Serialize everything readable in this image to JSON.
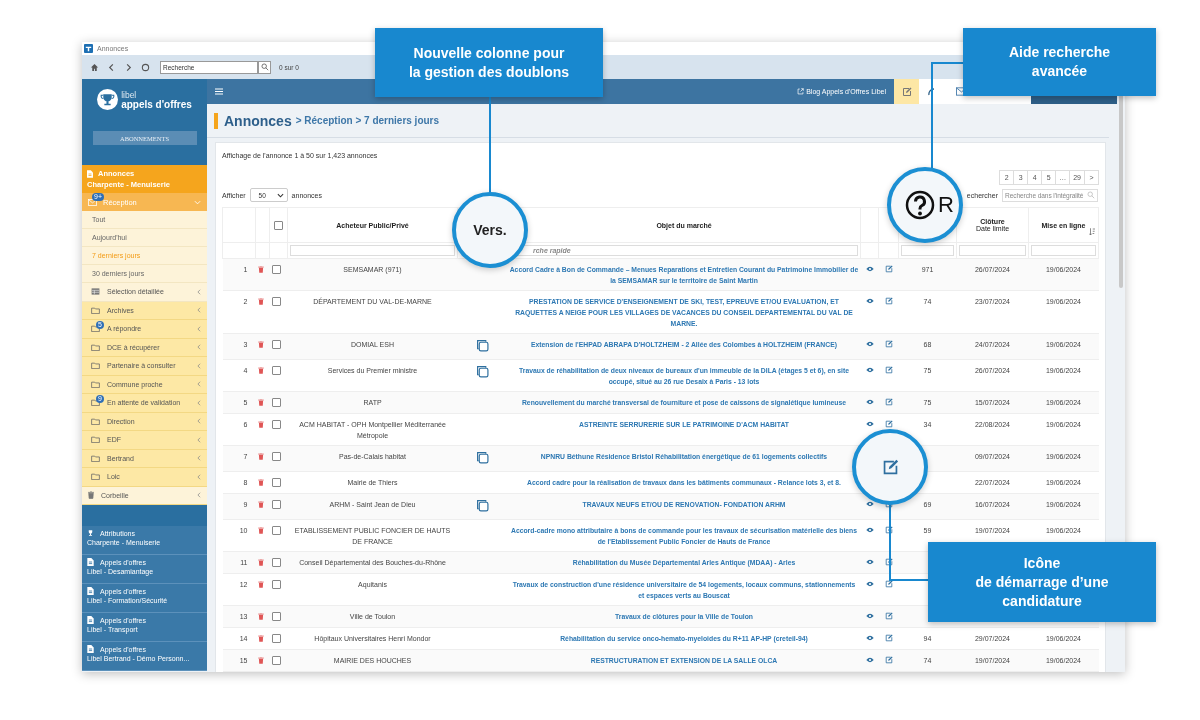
{
  "window": {
    "title": "Annonces"
  },
  "browser": {
    "search_value": "Recherche",
    "results": "0 sur 0"
  },
  "sidebar": {
    "logo": {
      "line1": "libel",
      "line2": "appels d'offres"
    },
    "subscriptions_button": "ABONNEMENTS",
    "current": {
      "title": "Annonces",
      "subtitle": "Charpente - Menuiserie"
    },
    "reception": {
      "label": "Réception",
      "badge": "9+",
      "expanded": true
    },
    "filters": [
      {
        "label": "Tout",
        "selected": false
      },
      {
        "label": "Aujourd'hui",
        "selected": false
      },
      {
        "label": "7 derniers jours",
        "selected": true
      },
      {
        "label": "30 derniers jours",
        "selected": false
      }
    ],
    "folders": [
      {
        "kind": "selection",
        "label": "Sélection détaillée"
      },
      {
        "kind": "folder",
        "label": "Archives"
      },
      {
        "kind": "folder",
        "label": "A répondre",
        "badge": "5"
      },
      {
        "kind": "folder",
        "label": "DCE à récupérer"
      },
      {
        "kind": "folder",
        "label": "Partenaire à consulter"
      },
      {
        "kind": "folder",
        "label": "Commune proche"
      },
      {
        "kind": "folder",
        "label": "En attente de validation",
        "badge": "9"
      },
      {
        "kind": "folder",
        "label": "Direction"
      },
      {
        "kind": "folder",
        "label": "EDF"
      },
      {
        "kind": "folder",
        "label": "Bertrand"
      },
      {
        "kind": "folder",
        "label": "Loic"
      },
      {
        "kind": "trash",
        "label": "Corbeille"
      }
    ],
    "subscriptions": [
      {
        "kind": "trophy",
        "title": "Attributions",
        "subtitle": "Charpente - Menuiserie"
      },
      {
        "kind": "document",
        "title": "Appels d'offres",
        "subtitle": "Libel - Desamiantage"
      },
      {
        "kind": "document",
        "title": "Appels d'offres",
        "subtitle": "Libel - Formation/Sécurité"
      },
      {
        "kind": "document",
        "title": "Appels d'offres",
        "subtitle": "Libel - Transport"
      },
      {
        "kind": "document",
        "title": "Appels d'offres",
        "subtitle": "Libel Bertrand - Démo Personn..."
      }
    ]
  },
  "topbar": {
    "blog_link": "Blog Appels d'Offres Libel"
  },
  "page": {
    "title": "Annonces",
    "breadcrumb": "> Réception > 7 derniers jours"
  },
  "listing": {
    "summary": "Affichage de l'annonce 1 à 50 sur 1,423 annonces",
    "show_label": "Afficher",
    "page_size": "50",
    "show_suffix": "annonces",
    "pagination": [
      {
        "label": "2",
        "selected": false
      },
      {
        "label": "3",
        "selected": false
      },
      {
        "label": "4",
        "selected": false
      },
      {
        "label": "5",
        "selected": false
      },
      {
        "label": "…",
        "selected": false
      },
      {
        "label": "29",
        "selected": false
      },
      {
        "label": ">",
        "selected": false
      }
    ],
    "search_label": "echercher",
    "search_placeholder": "Recherche dans l'intégralité"
  },
  "table": {
    "select_all_checked": false,
    "buyer_header": "Acheteur Public/Privé",
    "object_header": "Objet du marché",
    "closing_header": "Clôture",
    "closing_subheader": "Date limite",
    "online_header": "Mise en ligne",
    "filter_placeholder": "rche rapide",
    "rows": [
      {
        "number": "1",
        "checked": false,
        "buyer": "SEMSAMAR (971)",
        "duplicate": false,
        "object": "Accord Cadre à Bon de Commande – Menues Reparations et Entretien Courant du Patrimoine Immobilier de la SEMSAMAR sur le territoire de Saint Martin",
        "count": "971",
        "closing": "26/07/2024",
        "online": "19/06/2024"
      },
      {
        "number": "2",
        "checked": false,
        "buyer": "DÉPARTEMENT DU VAL-DE-MARNE",
        "duplicate": false,
        "object": "PRESTATION DE SERVICE D'ENSEIGNEMENT DE SKI, TEST, EPREUVE ET/OU EVALUATION, ET RAQUETTES A NEIGE POUR LES VILLAGES DE VACANCES DU CONSEIL DEPARTEMENTAL DU VAL DE MARNE.",
        "count": "74",
        "closing": "23/07/2024",
        "online": "19/06/2024"
      },
      {
        "number": "3",
        "checked": false,
        "buyer": "DOMIAL ESH",
        "duplicate": true,
        "object": "Extension de l'EHPAD ABRAPA D'HOLTZHEIM - 2 Allée des Colombes à HOLTZHEIM (FRANCE)",
        "count": "68",
        "closing": "24/07/2024",
        "online": "19/06/2024"
      },
      {
        "number": "4",
        "checked": false,
        "buyer": "Services du Premier ministre",
        "duplicate": true,
        "object": "Travaux de réhabilitation de deux niveaux de bureaux d'un immeuble de la DILA (étages 5 et 6), en site occupé, situé au 26 rue Desaix à Paris - 13 lots",
        "count": "75",
        "closing": "26/07/2024",
        "online": "19/06/2024"
      },
      {
        "number": "5",
        "checked": false,
        "buyer": "RATP",
        "duplicate": false,
        "object": "Renouvellement du marché transversal de fourniture et pose de caissons de signalétique lumineuse",
        "count": "75",
        "closing": "15/07/2024",
        "online": "19/06/2024"
      },
      {
        "number": "6",
        "checked": false,
        "buyer": "ACM HABITAT - OPH Montpellier Méditerranée Métropole",
        "duplicate": false,
        "object": "ASTREINTE SERRURERIE SUR LE PATRIMOINE D'ACM HABITAT",
        "count": "34",
        "closing": "22/08/2024",
        "online": "19/06/2024"
      },
      {
        "number": "7",
        "checked": false,
        "buyer": "Pas-de-Calais habitat",
        "duplicate": true,
        "object": "NPNRU Béthune Résidence Bristol Réhabilitation énergétique de 61 logements collectifs",
        "show_actions": false,
        "closing": "09/07/2024",
        "online": "19/06/2024"
      },
      {
        "number": "8",
        "checked": false,
        "buyer": "Mairie de Thiers",
        "duplicate": false,
        "object": "Accord cadre pour la réalisation de travaux dans les bâtiments communaux - Relance lots 3, et 8.",
        "show_actions": false,
        "closing": "22/07/2024",
        "online": "19/06/2024"
      },
      {
        "number": "9",
        "checked": false,
        "buyer": "ARHM - Saint Jean de Dieu",
        "duplicate": true,
        "object": "TRAVAUX NEUFS ET/OU DE RENOVATION- FONDATION ARHM",
        "count": "69",
        "closing": "16/07/2024",
        "online": "19/06/2024"
      },
      {
        "number": "10",
        "checked": false,
        "buyer": "ETABLISSEMENT PUBLIC FONCIER DE HAUTS DE FRANCE",
        "duplicate": false,
        "object": "Accord-cadre mono attributaire à bons de commande pour les travaux de sécurisation matérielle des biens de l'Etablissement Public Foncier de Hauts de France",
        "count": "59",
        "closing": "19/07/2024",
        "online": "19/06/2024"
      },
      {
        "number": "11",
        "checked": false,
        "buyer": "Conseil Départemental des Bouches-du-Rhône",
        "duplicate": false,
        "object": "Réhabilitation du Musée Départemental Arles Antique (MDAA) - Arles"
      },
      {
        "number": "12",
        "checked": false,
        "buyer": "Aquitanis",
        "duplicate": false,
        "object": "Travaux de construction d'une résidence universitaire de 54 logements, locaux communs, stationnements et espaces verts au Bouscat"
      },
      {
        "number": "13",
        "checked": false,
        "buyer": "Ville de Toulon",
        "duplicate": false,
        "object": "Travaux de clôtures pour la Ville de Toulon"
      },
      {
        "number": "14",
        "checked": false,
        "buyer": "Hôpitaux Universitaires Henri Mondor",
        "duplicate": false,
        "object": "Réhabilitation du service onco-hemato-myeloides du R+11 AP-HP (creteil-94)",
        "count": "94",
        "closing": "29/07/2024",
        "online": "19/06/2024"
      },
      {
        "number": "15",
        "checked": false,
        "buyer": "MAIRIE DES HOUCHES",
        "duplicate": false,
        "object": "RESTRUCTURATION ET EXTENSION DE LA SALLE OLCA",
        "count": "74",
        "closing": "19/07/2024",
        "online": "19/06/2024"
      }
    ]
  },
  "callouts": [
    {
      "kind": "column",
      "lines": [
        "Nouvelle colonne pour",
        "la gestion des doublons"
      ],
      "lens_text": "Vers."
    },
    {
      "kind": "search",
      "lines": [
        "Aide recherche",
        "avancée"
      ],
      "lens_text": "R"
    },
    {
      "kind": "edit",
      "lines": [
        "Icône",
        "de démarrage d’une",
        "candidature"
      ]
    }
  ]
}
